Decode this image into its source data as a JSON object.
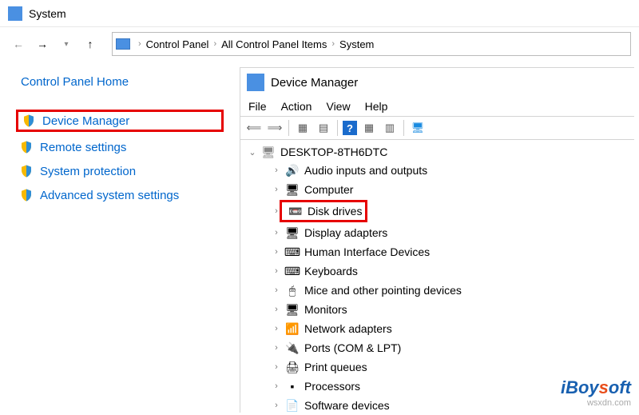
{
  "titlebar": {
    "title": "System"
  },
  "breadcrumbs": [
    "Control Panel",
    "All Control Panel Items",
    "System"
  ],
  "left_nav": {
    "home": "Control Panel Home",
    "items": [
      {
        "label": "Device Manager",
        "highlight": true
      },
      {
        "label": "Remote settings"
      },
      {
        "label": "System protection"
      },
      {
        "label": "Advanced system settings"
      }
    ]
  },
  "devmgr": {
    "title": "Device Manager",
    "menu": [
      "File",
      "Action",
      "View",
      "Help"
    ],
    "root": "DESKTOP-8TH6DTC",
    "nodes": [
      {
        "label": "Audio inputs and outputs",
        "icon": "🔊"
      },
      {
        "label": "Computer",
        "icon": "🖥"
      },
      {
        "label": "Disk drives",
        "icon": "📼",
        "highlight": true
      },
      {
        "label": "Display adapters",
        "icon": "🖥"
      },
      {
        "label": "Human Interface Devices",
        "icon": "⌨"
      },
      {
        "label": "Keyboards",
        "icon": "⌨"
      },
      {
        "label": "Mice and other pointing devices",
        "icon": "🖱"
      },
      {
        "label": "Monitors",
        "icon": "🖥"
      },
      {
        "label": "Network adapters",
        "icon": "📶"
      },
      {
        "label": "Ports (COM & LPT)",
        "icon": "🔌"
      },
      {
        "label": "Print queues",
        "icon": "🖨"
      },
      {
        "label": "Processors",
        "icon": "▪"
      },
      {
        "label": "Software devices",
        "icon": "📄"
      }
    ]
  },
  "watermark": {
    "brand_letters": [
      "i",
      "B",
      "oy",
      "s",
      "oft"
    ],
    "url": "wsxdn.com"
  }
}
